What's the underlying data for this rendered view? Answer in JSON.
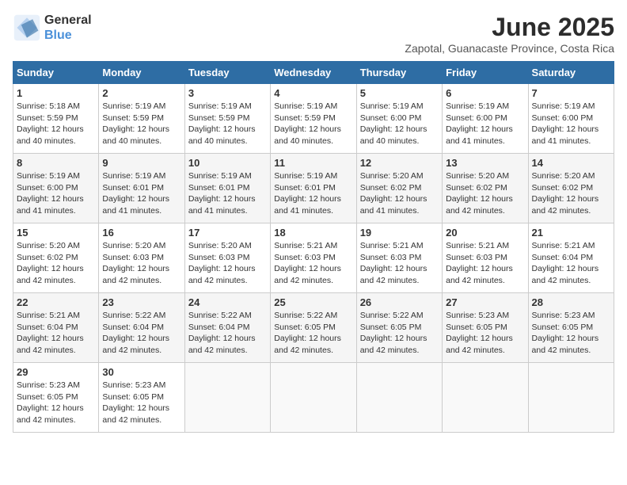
{
  "logo": {
    "line1": "General",
    "line2": "Blue"
  },
  "calendar": {
    "title": "June 2025",
    "subtitle": "Zapotal, Guanacaste Province, Costa Rica"
  },
  "weekdays": [
    "Sunday",
    "Monday",
    "Tuesday",
    "Wednesday",
    "Thursday",
    "Friday",
    "Saturday"
  ],
  "weeks": [
    [
      {
        "day": "1",
        "sunrise": "5:18 AM",
        "sunset": "5:59 PM",
        "daylight": "12 hours and 40 minutes."
      },
      {
        "day": "2",
        "sunrise": "5:19 AM",
        "sunset": "5:59 PM",
        "daylight": "12 hours and 40 minutes."
      },
      {
        "day": "3",
        "sunrise": "5:19 AM",
        "sunset": "5:59 PM",
        "daylight": "12 hours and 40 minutes."
      },
      {
        "day": "4",
        "sunrise": "5:19 AM",
        "sunset": "5:59 PM",
        "daylight": "12 hours and 40 minutes."
      },
      {
        "day": "5",
        "sunrise": "5:19 AM",
        "sunset": "6:00 PM",
        "daylight": "12 hours and 40 minutes."
      },
      {
        "day": "6",
        "sunrise": "5:19 AM",
        "sunset": "6:00 PM",
        "daylight": "12 hours and 41 minutes."
      },
      {
        "day": "7",
        "sunrise": "5:19 AM",
        "sunset": "6:00 PM",
        "daylight": "12 hours and 41 minutes."
      }
    ],
    [
      {
        "day": "8",
        "sunrise": "5:19 AM",
        "sunset": "6:00 PM",
        "daylight": "12 hours and 41 minutes."
      },
      {
        "day": "9",
        "sunrise": "5:19 AM",
        "sunset": "6:01 PM",
        "daylight": "12 hours and 41 minutes."
      },
      {
        "day": "10",
        "sunrise": "5:19 AM",
        "sunset": "6:01 PM",
        "daylight": "12 hours and 41 minutes."
      },
      {
        "day": "11",
        "sunrise": "5:19 AM",
        "sunset": "6:01 PM",
        "daylight": "12 hours and 41 minutes."
      },
      {
        "day": "12",
        "sunrise": "5:20 AM",
        "sunset": "6:02 PM",
        "daylight": "12 hours and 41 minutes."
      },
      {
        "day": "13",
        "sunrise": "5:20 AM",
        "sunset": "6:02 PM",
        "daylight": "12 hours and 42 minutes."
      },
      {
        "day": "14",
        "sunrise": "5:20 AM",
        "sunset": "6:02 PM",
        "daylight": "12 hours and 42 minutes."
      }
    ],
    [
      {
        "day": "15",
        "sunrise": "5:20 AM",
        "sunset": "6:02 PM",
        "daylight": "12 hours and 42 minutes."
      },
      {
        "day": "16",
        "sunrise": "5:20 AM",
        "sunset": "6:03 PM",
        "daylight": "12 hours and 42 minutes."
      },
      {
        "day": "17",
        "sunrise": "5:20 AM",
        "sunset": "6:03 PM",
        "daylight": "12 hours and 42 minutes."
      },
      {
        "day": "18",
        "sunrise": "5:21 AM",
        "sunset": "6:03 PM",
        "daylight": "12 hours and 42 minutes."
      },
      {
        "day": "19",
        "sunrise": "5:21 AM",
        "sunset": "6:03 PM",
        "daylight": "12 hours and 42 minutes."
      },
      {
        "day": "20",
        "sunrise": "5:21 AM",
        "sunset": "6:03 PM",
        "daylight": "12 hours and 42 minutes."
      },
      {
        "day": "21",
        "sunrise": "5:21 AM",
        "sunset": "6:04 PM",
        "daylight": "12 hours and 42 minutes."
      }
    ],
    [
      {
        "day": "22",
        "sunrise": "5:21 AM",
        "sunset": "6:04 PM",
        "daylight": "12 hours and 42 minutes."
      },
      {
        "day": "23",
        "sunrise": "5:22 AM",
        "sunset": "6:04 PM",
        "daylight": "12 hours and 42 minutes."
      },
      {
        "day": "24",
        "sunrise": "5:22 AM",
        "sunset": "6:04 PM",
        "daylight": "12 hours and 42 minutes."
      },
      {
        "day": "25",
        "sunrise": "5:22 AM",
        "sunset": "6:05 PM",
        "daylight": "12 hours and 42 minutes."
      },
      {
        "day": "26",
        "sunrise": "5:22 AM",
        "sunset": "6:05 PM",
        "daylight": "12 hours and 42 minutes."
      },
      {
        "day": "27",
        "sunrise": "5:23 AM",
        "sunset": "6:05 PM",
        "daylight": "12 hours and 42 minutes."
      },
      {
        "day": "28",
        "sunrise": "5:23 AM",
        "sunset": "6:05 PM",
        "daylight": "12 hours and 42 minutes."
      }
    ],
    [
      {
        "day": "29",
        "sunrise": "5:23 AM",
        "sunset": "6:05 PM",
        "daylight": "12 hours and 42 minutes."
      },
      {
        "day": "30",
        "sunrise": "5:23 AM",
        "sunset": "6:05 PM",
        "daylight": "12 hours and 42 minutes."
      },
      null,
      null,
      null,
      null,
      null
    ]
  ],
  "labels": {
    "sunrise": "Sunrise:",
    "sunset": "Sunset:",
    "daylight": "Daylight:"
  }
}
